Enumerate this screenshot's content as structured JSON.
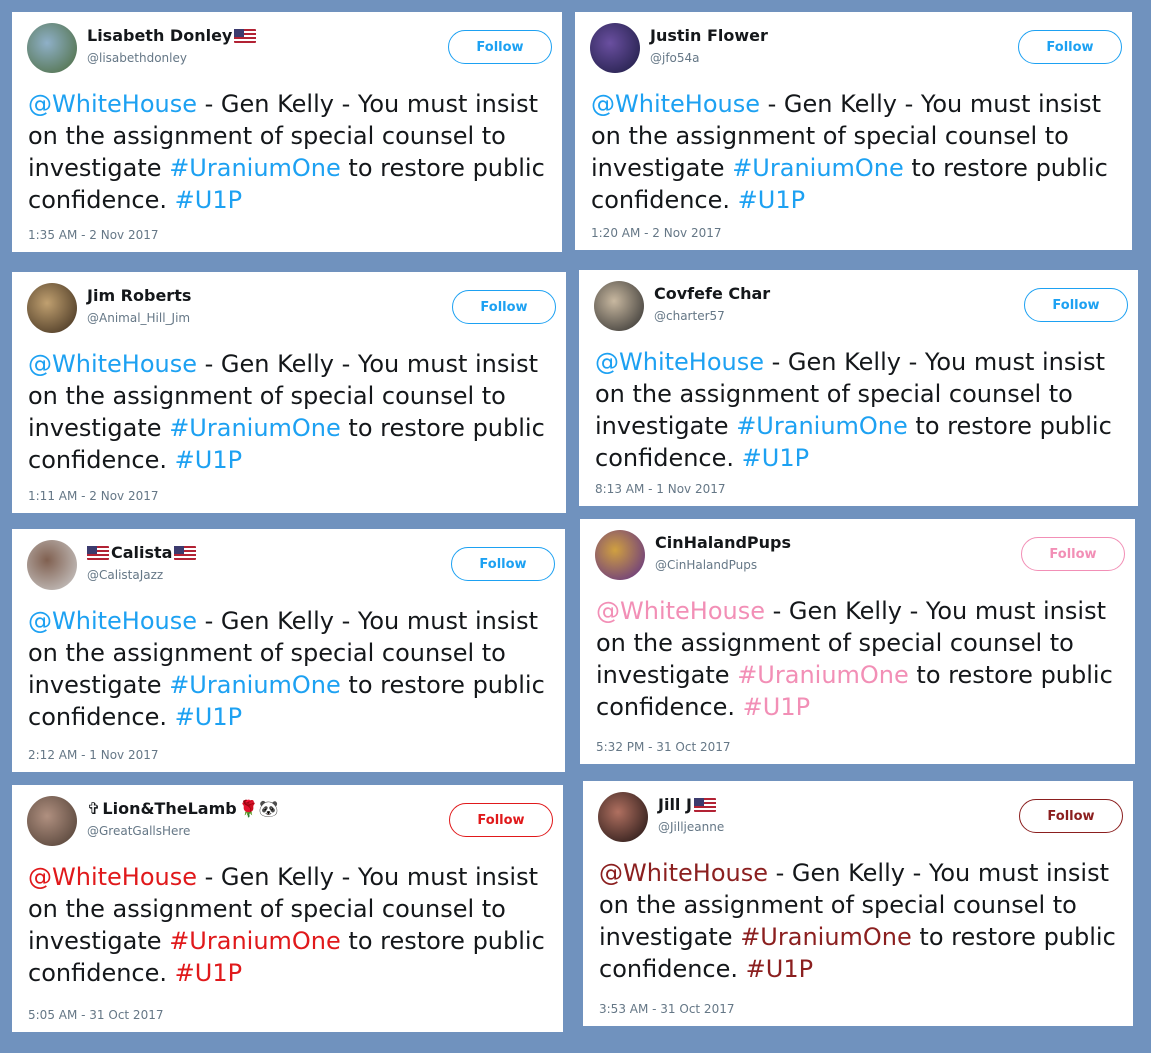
{
  "tweets": [
    {
      "name": "Lisabeth Donley",
      "name_prefix": "",
      "suffix_emoji": "",
      "flag_after": true,
      "flag_before": false,
      "handle": "@lisabethdonley",
      "follow_label": "Follow",
      "accent": "#1da1f2",
      "avatar_colors": [
        "#4a6a3a",
        "#8fb0c8"
      ],
      "mention": "@WhiteHouse",
      "text_1": " - Gen Kelly - You must insist on the assignment of special counsel to investigate ",
      "hashtag_1": "#UraniumOne",
      "text_2": " to restore public confidence. ",
      "hashtag_2": "#U1P",
      "timestamp": "1:35 AM - 2 Nov 2017"
    },
    {
      "name": "Justin Flower",
      "name_prefix": "",
      "suffix_emoji": "",
      "flag_after": false,
      "flag_before": false,
      "handle": "@jfo54a",
      "follow_label": "Follow",
      "accent": "#1da1f2",
      "avatar_colors": [
        "#1a1a40",
        "#6a4fa0"
      ],
      "mention": "@WhiteHouse",
      "text_1": " - Gen Kelly - You must insist on the assignment of special counsel to investigate ",
      "hashtag_1": "#UraniumOne",
      "text_2": " to restore public confidence. ",
      "hashtag_2": "#U1P",
      "timestamp": "1:20 AM - 2 Nov 2017"
    },
    {
      "name": "Jim Roberts",
      "name_prefix": "",
      "suffix_emoji": "",
      "flag_after": false,
      "flag_before": false,
      "handle": "@Animal_Hill_Jim",
      "follow_label": "Follow",
      "accent": "#1da1f2",
      "avatar_colors": [
        "#3a2a1a",
        "#c0a070"
      ],
      "mention": "@WhiteHouse",
      "text_1": " - Gen Kelly - You must insist on the assignment of special counsel to investigate ",
      "hashtag_1": "#UraniumOne",
      "text_2": " to restore public confidence. ",
      "hashtag_2": "#U1P",
      "timestamp": "1:11 AM - 2 Nov 2017"
    },
    {
      "name": "Covfefe Char",
      "name_prefix": "",
      "suffix_emoji": "",
      "flag_after": false,
      "flag_before": false,
      "handle": "@charter57",
      "follow_label": "Follow",
      "accent": "#1da1f2",
      "avatar_colors": [
        "#2a2a2a",
        "#c8b8a0"
      ],
      "mention": "@WhiteHouse",
      "text_1": " - Gen Kelly - You must insist on the assignment of special counsel to investigate ",
      "hashtag_1": "#UraniumOne",
      "text_2": " to restore public confidence. ",
      "hashtag_2": "#U1P",
      "timestamp": "8:13 AM - 1 Nov 2017"
    },
    {
      "name": "Calista",
      "name_prefix": "",
      "suffix_emoji": "",
      "flag_after": true,
      "flag_before": true,
      "handle": "@CalistaJazz",
      "follow_label": "Follow",
      "accent": "#1da1f2",
      "avatar_colors": [
        "#d0d0d0",
        "#806050"
      ],
      "mention": "@WhiteHouse",
      "text_1": " - Gen Kelly - You must insist on the assignment of special counsel to investigate ",
      "hashtag_1": "#UraniumOne",
      "text_2": " to restore public confidence. ",
      "hashtag_2": "#U1P",
      "timestamp": "2:12 AM - 1 Nov 2017"
    },
    {
      "name": "CinHalandPups",
      "name_prefix": "",
      "suffix_emoji": "",
      "flag_after": false,
      "flag_before": false,
      "handle": "@CinHalandPups",
      "follow_label": "Follow",
      "accent": "#f28fb6",
      "avatar_colors": [
        "#5a2a8a",
        "#d0a040"
      ],
      "mention": "@WhiteHouse",
      "text_1": " - Gen Kelly - You must insist on the assignment of special counsel to investigate ",
      "hashtag_1": "#UraniumOne",
      "text_2": " to restore public confidence. ",
      "hashtag_2": "#U1P",
      "timestamp": "5:32 PM - 31 Oct 2017"
    },
    {
      "name": "Lion&TheLamb",
      "name_prefix": "✞",
      "suffix_emoji": "🌹🐼",
      "flag_after": false,
      "flag_before": false,
      "handle": "@GreatGallsHere",
      "follow_label": "Follow",
      "accent": "#e0191b",
      "avatar_colors": [
        "#4a3a30",
        "#b09080"
      ],
      "mention": "@WhiteHouse",
      "text_1": " - Gen Kelly - You must insist on the assignment of special counsel to investigate ",
      "hashtag_1": "#UraniumOne",
      "text_2": " to restore public confidence. ",
      "hashtag_2": "#U1P",
      "timestamp": "5:05 AM - 31 Oct 2017"
    },
    {
      "name": "Jill J",
      "name_prefix": "",
      "suffix_emoji": "",
      "flag_after": true,
      "flag_before": false,
      "handle": "@Jilljeanne",
      "follow_label": "Follow",
      "accent": "#8b1f1f",
      "avatar_colors": [
        "#1a1010",
        "#b07060"
      ],
      "mention": "@WhiteHouse",
      "text_1": " - Gen Kelly - You must insist on the assignment of special counsel to investigate ",
      "hashtag_1": "#UraniumOne",
      "text_2": " to restore public confidence. ",
      "hashtag_2": "#U1P",
      "timestamp": "3:53 AM - 31 Oct 2017"
    }
  ]
}
